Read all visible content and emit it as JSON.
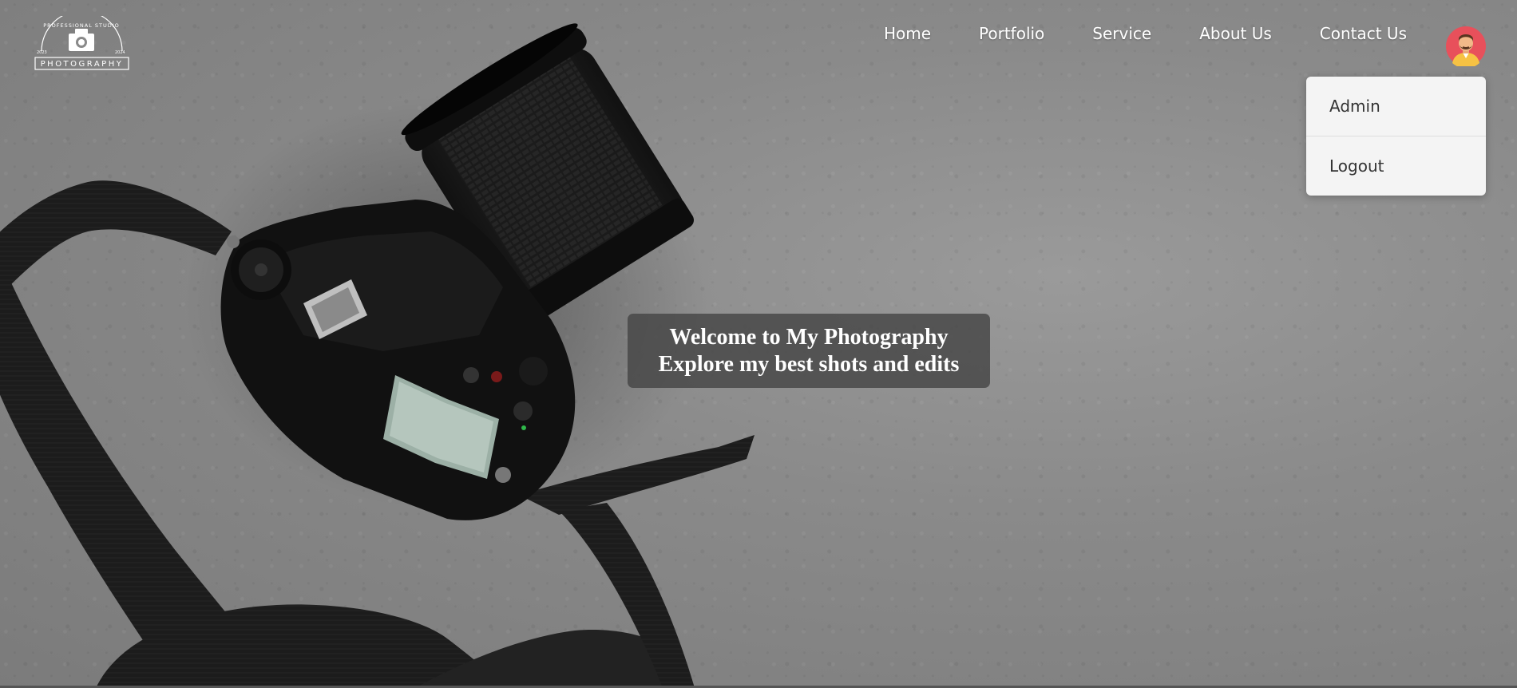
{
  "logo": {
    "arc_text": "PROFESSIONAL STUDIO",
    "left_year": "2023",
    "right_year": "2024",
    "wordmark": "PHOTOGRAPHY"
  },
  "nav": {
    "items": [
      {
        "label": "Home"
      },
      {
        "label": "Portfolio"
      },
      {
        "label": "Service"
      },
      {
        "label": "About Us"
      },
      {
        "label": "Contact Us"
      }
    ]
  },
  "user_menu": {
    "items": [
      {
        "label": "Admin"
      },
      {
        "label": "Logout"
      }
    ]
  },
  "hero": {
    "line1": "Welcome to My Photography",
    "line2": "Explore my best shots and edits"
  },
  "colors": {
    "nav_text": "#ffffff",
    "dropdown_bg": "#f4f4f4",
    "overlay_bg": "#464646",
    "avatar_bg": "#e8505b"
  }
}
